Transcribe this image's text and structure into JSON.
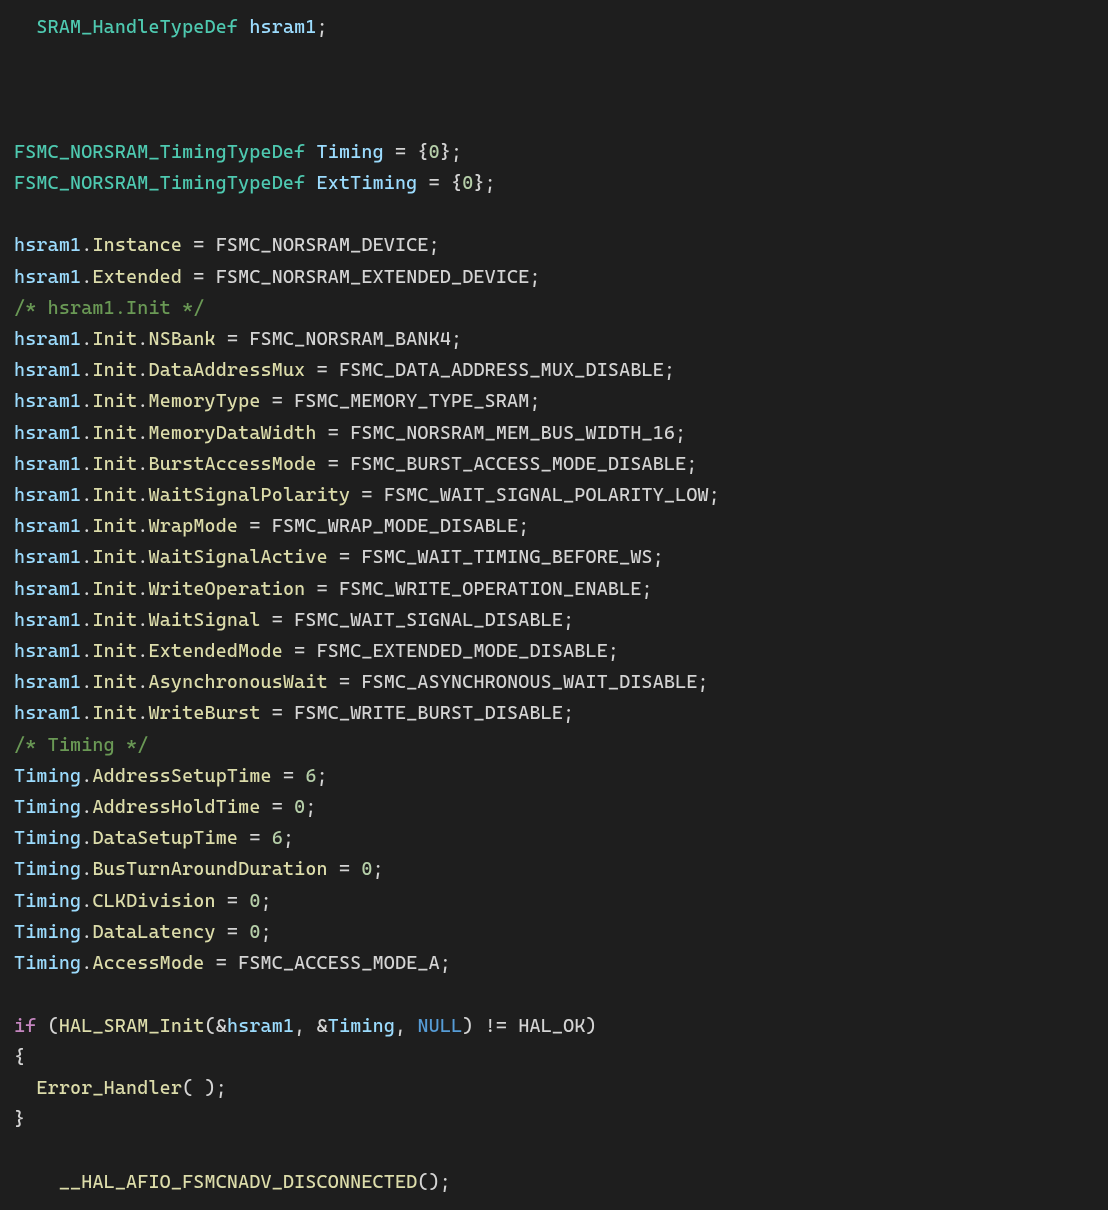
{
  "code": {
    "lines": [
      {
        "indent": 1,
        "empty": false,
        "tokens": [
          [
            "type",
            "SRAM_HandleTypeDef"
          ],
          [
            "punc",
            " "
          ],
          [
            "var",
            "hsram1"
          ],
          [
            "punc",
            ";"
          ]
        ]
      },
      {
        "empty": true
      },
      {
        "empty": true
      },
      {
        "empty": true
      },
      {
        "indent": 0,
        "tokens": [
          [
            "type",
            "FSMC_NORSRAM_TimingTypeDef"
          ],
          [
            "punc",
            " "
          ],
          [
            "var",
            "Timing"
          ],
          [
            "punc",
            " = {"
          ],
          [
            "num",
            "0"
          ],
          [
            "punc",
            "};"
          ]
        ]
      },
      {
        "indent": 0,
        "tokens": [
          [
            "type",
            "FSMC_NORSRAM_TimingTypeDef"
          ],
          [
            "punc",
            " "
          ],
          [
            "var",
            "ExtTiming"
          ],
          [
            "punc",
            " = {"
          ],
          [
            "num",
            "0"
          ],
          [
            "punc",
            "};"
          ]
        ]
      },
      {
        "empty": true
      },
      {
        "indent": 0,
        "tokens": [
          [
            "obj",
            "hsram1"
          ],
          [
            "punc",
            "."
          ],
          [
            "member",
            "Instance"
          ],
          [
            "punc",
            " = "
          ],
          [
            "macro",
            "FSMC_NORSRAM_DEVICE"
          ],
          [
            "punc",
            ";"
          ]
        ]
      },
      {
        "indent": 0,
        "tokens": [
          [
            "obj",
            "hsram1"
          ],
          [
            "punc",
            "."
          ],
          [
            "member",
            "Extended"
          ],
          [
            "punc",
            " = "
          ],
          [
            "macro",
            "FSMC_NORSRAM_EXTENDED_DEVICE"
          ],
          [
            "punc",
            ";"
          ]
        ]
      },
      {
        "indent": 0,
        "tokens": [
          [
            "comment",
            "/* hsram1.Init */"
          ]
        ]
      },
      {
        "indent": 0,
        "tokens": [
          [
            "obj",
            "hsram1"
          ],
          [
            "punc",
            "."
          ],
          [
            "member",
            "Init"
          ],
          [
            "punc",
            "."
          ],
          [
            "member",
            "NSBank"
          ],
          [
            "punc",
            " = "
          ],
          [
            "macro",
            "FSMC_NORSRAM_BANK4"
          ],
          [
            "punc",
            ";"
          ]
        ]
      },
      {
        "indent": 0,
        "tokens": [
          [
            "obj",
            "hsram1"
          ],
          [
            "punc",
            "."
          ],
          [
            "member",
            "Init"
          ],
          [
            "punc",
            "."
          ],
          [
            "member",
            "DataAddressMux"
          ],
          [
            "punc",
            " = "
          ],
          [
            "macro",
            "FSMC_DATA_ADDRESS_MUX_DISABLE"
          ],
          [
            "punc",
            ";"
          ]
        ]
      },
      {
        "indent": 0,
        "tokens": [
          [
            "obj",
            "hsram1"
          ],
          [
            "punc",
            "."
          ],
          [
            "member",
            "Init"
          ],
          [
            "punc",
            "."
          ],
          [
            "member",
            "MemoryType"
          ],
          [
            "punc",
            " = "
          ],
          [
            "macro",
            "FSMC_MEMORY_TYPE_SRAM"
          ],
          [
            "punc",
            ";"
          ]
        ]
      },
      {
        "indent": 0,
        "tokens": [
          [
            "obj",
            "hsram1"
          ],
          [
            "punc",
            "."
          ],
          [
            "member",
            "Init"
          ],
          [
            "punc",
            "."
          ],
          [
            "member",
            "MemoryDataWidth"
          ],
          [
            "punc",
            " = "
          ],
          [
            "macro",
            "FSMC_NORSRAM_MEM_BUS_WIDTH_16"
          ],
          [
            "punc",
            ";"
          ]
        ]
      },
      {
        "indent": 0,
        "tokens": [
          [
            "obj",
            "hsram1"
          ],
          [
            "punc",
            "."
          ],
          [
            "member",
            "Init"
          ],
          [
            "punc",
            "."
          ],
          [
            "member",
            "BurstAccessMode"
          ],
          [
            "punc",
            " = "
          ],
          [
            "macro",
            "FSMC_BURST_ACCESS_MODE_DISABLE"
          ],
          [
            "punc",
            ";"
          ]
        ]
      },
      {
        "indent": 0,
        "tokens": [
          [
            "obj",
            "hsram1"
          ],
          [
            "punc",
            "."
          ],
          [
            "member",
            "Init"
          ],
          [
            "punc",
            "."
          ],
          [
            "member",
            "WaitSignalPolarity"
          ],
          [
            "punc",
            " = "
          ],
          [
            "macro",
            "FSMC_WAIT_SIGNAL_POLARITY_LOW"
          ],
          [
            "punc",
            ";"
          ]
        ]
      },
      {
        "indent": 0,
        "tokens": [
          [
            "obj",
            "hsram1"
          ],
          [
            "punc",
            "."
          ],
          [
            "member",
            "Init"
          ],
          [
            "punc",
            "."
          ],
          [
            "member",
            "WrapMode"
          ],
          [
            "punc",
            " = "
          ],
          [
            "macro",
            "FSMC_WRAP_MODE_DISABLE"
          ],
          [
            "punc",
            ";"
          ]
        ]
      },
      {
        "indent": 0,
        "tokens": [
          [
            "obj",
            "hsram1"
          ],
          [
            "punc",
            "."
          ],
          [
            "member",
            "Init"
          ],
          [
            "punc",
            "."
          ],
          [
            "member",
            "WaitSignalActive"
          ],
          [
            "punc",
            " = "
          ],
          [
            "macro",
            "FSMC_WAIT_TIMING_BEFORE_WS"
          ],
          [
            "punc",
            ";"
          ]
        ]
      },
      {
        "indent": 0,
        "tokens": [
          [
            "obj",
            "hsram1"
          ],
          [
            "punc",
            "."
          ],
          [
            "member",
            "Init"
          ],
          [
            "punc",
            "."
          ],
          [
            "member",
            "WriteOperation"
          ],
          [
            "punc",
            " = "
          ],
          [
            "macro",
            "FSMC_WRITE_OPERATION_ENABLE"
          ],
          [
            "punc",
            ";"
          ]
        ]
      },
      {
        "indent": 0,
        "tokens": [
          [
            "obj",
            "hsram1"
          ],
          [
            "punc",
            "."
          ],
          [
            "member",
            "Init"
          ],
          [
            "punc",
            "."
          ],
          [
            "member",
            "WaitSignal"
          ],
          [
            "punc",
            " = "
          ],
          [
            "macro",
            "FSMC_WAIT_SIGNAL_DISABLE"
          ],
          [
            "punc",
            ";"
          ]
        ]
      },
      {
        "indent": 0,
        "tokens": [
          [
            "obj",
            "hsram1"
          ],
          [
            "punc",
            "."
          ],
          [
            "member",
            "Init"
          ],
          [
            "punc",
            "."
          ],
          [
            "member",
            "ExtendedMode"
          ],
          [
            "punc",
            " = "
          ],
          [
            "macro",
            "FSMC_EXTENDED_MODE_DISABLE"
          ],
          [
            "punc",
            ";"
          ]
        ]
      },
      {
        "indent": 0,
        "tokens": [
          [
            "obj",
            "hsram1"
          ],
          [
            "punc",
            "."
          ],
          [
            "member",
            "Init"
          ],
          [
            "punc",
            "."
          ],
          [
            "member",
            "AsynchronousWait"
          ],
          [
            "punc",
            " = "
          ],
          [
            "macro",
            "FSMC_ASYNCHRONOUS_WAIT_DISABLE"
          ],
          [
            "punc",
            ";"
          ]
        ]
      },
      {
        "indent": 0,
        "tokens": [
          [
            "obj",
            "hsram1"
          ],
          [
            "punc",
            "."
          ],
          [
            "member",
            "Init"
          ],
          [
            "punc",
            "."
          ],
          [
            "member",
            "WriteBurst"
          ],
          [
            "punc",
            " = "
          ],
          [
            "macro",
            "FSMC_WRITE_BURST_DISABLE"
          ],
          [
            "punc",
            ";"
          ]
        ]
      },
      {
        "indent": 0,
        "tokens": [
          [
            "comment",
            "/* Timing */"
          ]
        ]
      },
      {
        "indent": 0,
        "tokens": [
          [
            "obj",
            "Timing"
          ],
          [
            "punc",
            "."
          ],
          [
            "member",
            "AddressSetupTime"
          ],
          [
            "punc",
            " = "
          ],
          [
            "num",
            "6"
          ],
          [
            "punc",
            ";"
          ]
        ]
      },
      {
        "indent": 0,
        "tokens": [
          [
            "obj",
            "Timing"
          ],
          [
            "punc",
            "."
          ],
          [
            "member",
            "AddressHoldTime"
          ],
          [
            "punc",
            " = "
          ],
          [
            "num",
            "0"
          ],
          [
            "punc",
            ";"
          ]
        ]
      },
      {
        "indent": 0,
        "tokens": [
          [
            "obj",
            "Timing"
          ],
          [
            "punc",
            "."
          ],
          [
            "member",
            "DataSetupTime"
          ],
          [
            "punc",
            " = "
          ],
          [
            "num",
            "6"
          ],
          [
            "punc",
            ";"
          ]
        ]
      },
      {
        "indent": 0,
        "tokens": [
          [
            "obj",
            "Timing"
          ],
          [
            "punc",
            "."
          ],
          [
            "member",
            "BusTurnAroundDuration"
          ],
          [
            "punc",
            " = "
          ],
          [
            "num",
            "0"
          ],
          [
            "punc",
            ";"
          ]
        ]
      },
      {
        "indent": 0,
        "tokens": [
          [
            "obj",
            "Timing"
          ],
          [
            "punc",
            "."
          ],
          [
            "member",
            "CLKDivision"
          ],
          [
            "punc",
            " = "
          ],
          [
            "num",
            "0"
          ],
          [
            "punc",
            ";"
          ]
        ]
      },
      {
        "indent": 0,
        "tokens": [
          [
            "obj",
            "Timing"
          ],
          [
            "punc",
            "."
          ],
          [
            "member",
            "DataLatency"
          ],
          [
            "punc",
            " = "
          ],
          [
            "num",
            "0"
          ],
          [
            "punc",
            ";"
          ]
        ]
      },
      {
        "indent": 0,
        "tokens": [
          [
            "obj",
            "Timing"
          ],
          [
            "punc",
            "."
          ],
          [
            "member",
            "AccessMode"
          ],
          [
            "punc",
            " = "
          ],
          [
            "macro",
            "FSMC_ACCESS_MODE_A"
          ],
          [
            "punc",
            ";"
          ]
        ]
      },
      {
        "empty": true
      },
      {
        "indent": 0,
        "tokens": [
          [
            "keyword",
            "if"
          ],
          [
            "punc",
            " ("
          ],
          [
            "func",
            "HAL_SRAM_Init"
          ],
          [
            "punc",
            "(&"
          ],
          [
            "obj",
            "hsram1"
          ],
          [
            "punc",
            ", &"
          ],
          [
            "obj",
            "Timing"
          ],
          [
            "punc",
            ", "
          ],
          [
            "null",
            "NULL"
          ],
          [
            "punc",
            ") != "
          ],
          [
            "macro",
            "HAL_OK"
          ],
          [
            "punc",
            ")"
          ]
        ]
      },
      {
        "indent": 0,
        "tokens": [
          [
            "punc",
            "{"
          ]
        ]
      },
      {
        "indent": 1,
        "tokens": [
          [
            "func",
            "Error_Handler"
          ],
          [
            "punc",
            "( );"
          ]
        ]
      },
      {
        "indent": 0,
        "tokens": [
          [
            "punc",
            "}"
          ]
        ]
      },
      {
        "empty": true
      },
      {
        "indent": 2,
        "tokens": [
          [
            "func",
            "__HAL_AFIO_FSMCNADV_DISCONNECTED"
          ],
          [
            "punc",
            "();"
          ]
        ]
      }
    ]
  }
}
